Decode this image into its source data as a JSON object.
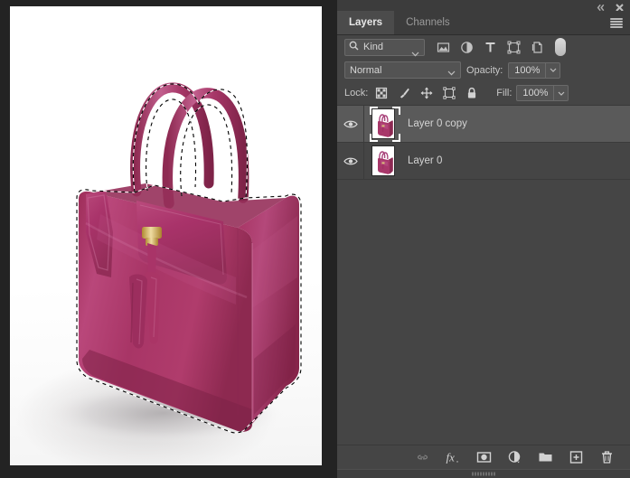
{
  "window": {
    "background_color": "#232323",
    "panel_background": "#454545",
    "accent_selected_row": "#5a5a5a"
  },
  "document": {
    "canvas_background": "#ffffff",
    "subject": "pink-leather-handbag",
    "selection_active": true,
    "selection_style": "marching-ants",
    "bag_color": "#b03a68",
    "bag_color_dark": "#8e2d52",
    "bag_color_light": "#c4578a",
    "hardware_color": "#c9a24a"
  },
  "dock": {
    "collapse_icon": "collapse-to-icons",
    "close_icon": "close-panel",
    "menu_icon": "panel-menu"
  },
  "tabs": [
    {
      "label": "Layers",
      "active": true
    },
    {
      "label": "Channels",
      "active": false
    }
  ],
  "filter_row": {
    "search_icon": "search-icon",
    "kind_label": "Kind",
    "kind_dropdown_icon": "chevron-down-icon",
    "filters": [
      {
        "name": "filter-pixel-layers",
        "icon": "image-icon"
      },
      {
        "name": "filter-adjustment-layers",
        "icon": "half-circle-icon"
      },
      {
        "name": "filter-type-layers",
        "icon": "text-t-icon"
      },
      {
        "name": "filter-shape-layers",
        "icon": "shape-bounds-icon"
      },
      {
        "name": "filter-smart-objects",
        "icon": "smart-object-icon"
      }
    ],
    "toggle_name": "filter-enable-toggle"
  },
  "blend_row": {
    "blend_mode": "Normal",
    "blend_dropdown_icon": "chevron-down-icon",
    "opacity_label": "Opacity:",
    "opacity_value": "100%",
    "opacity_stepper_icon": "chevron-down-icon"
  },
  "lock_row": {
    "lock_label": "Lock:",
    "locks": [
      {
        "name": "lock-transparent-pixels",
        "icon": "checkerboard-icon"
      },
      {
        "name": "lock-image-pixels",
        "icon": "brush-icon"
      },
      {
        "name": "lock-position",
        "icon": "move-arrows-icon"
      },
      {
        "name": "lock-artboard-nesting",
        "icon": "artboard-icon"
      },
      {
        "name": "lock-all",
        "icon": "padlock-icon"
      }
    ],
    "fill_label": "Fill:",
    "fill_value": "100%",
    "fill_stepper_icon": "chevron-down-icon"
  },
  "layers": [
    {
      "name": "Layer 0 copy",
      "visible": true,
      "selected": true,
      "thumbnail": "handbag-thumbnail",
      "eye_icon": "eye-icon"
    },
    {
      "name": "Layer 0",
      "visible": true,
      "selected": false,
      "thumbnail": "handbag-thumbnail",
      "eye_icon": "eye-icon"
    }
  ],
  "footer_buttons": [
    {
      "name": "link-layers-button",
      "icon": "chain-link-icon",
      "disabled": true
    },
    {
      "name": "layer-style-button",
      "icon": "fx-icon",
      "disabled": false
    },
    {
      "name": "add-layer-mask-button",
      "icon": "mask-rect-icon",
      "disabled": false
    },
    {
      "name": "new-adjustment-layer-button",
      "icon": "half-circle-icon",
      "disabled": false
    },
    {
      "name": "new-group-button",
      "icon": "folder-icon",
      "disabled": false
    },
    {
      "name": "new-layer-button",
      "icon": "plus-square-icon",
      "disabled": false
    },
    {
      "name": "delete-layer-button",
      "icon": "trash-icon",
      "disabled": false
    }
  ],
  "resize_grip": "panel-resize-grip"
}
